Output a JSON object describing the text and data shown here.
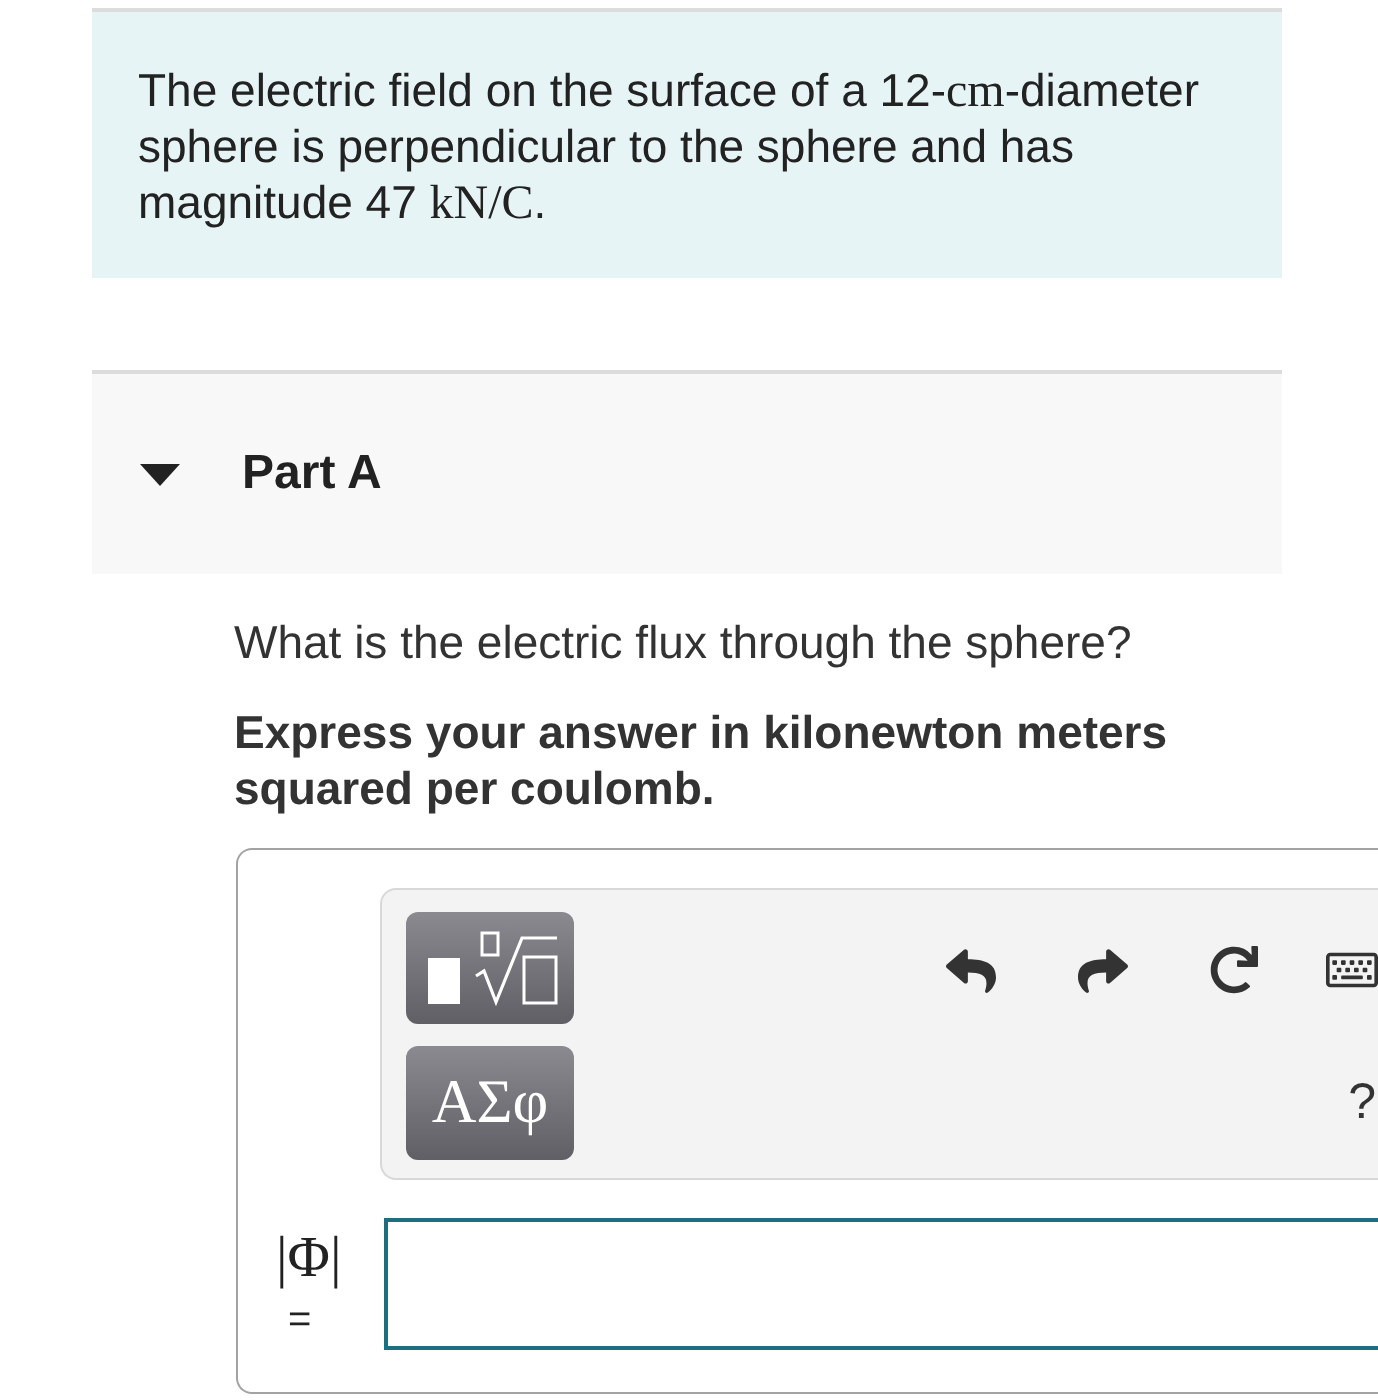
{
  "problem": {
    "statement": [
      {
        "kind": "text",
        "text": "The electric field on the surface of a 12-"
      },
      {
        "kind": "math",
        "text": "cm"
      },
      {
        "kind": "text",
        "text": "-diameter sphere is perpendicular to the sphere and has magnitude 47 "
      },
      {
        "kind": "math",
        "text": "kN/C"
      },
      {
        "kind": "text",
        "text": "."
      }
    ]
  },
  "part": {
    "title": "Part A",
    "expanded": true,
    "question": "What is the electric flux through the sphere?",
    "instruction": "Express your answer in kilonewton meters squared per coulomb.",
    "answer": {
      "symbol_button": "ΑΣφ",
      "help": "?",
      "label": "|Φ|",
      "relation": "="
    }
  }
}
